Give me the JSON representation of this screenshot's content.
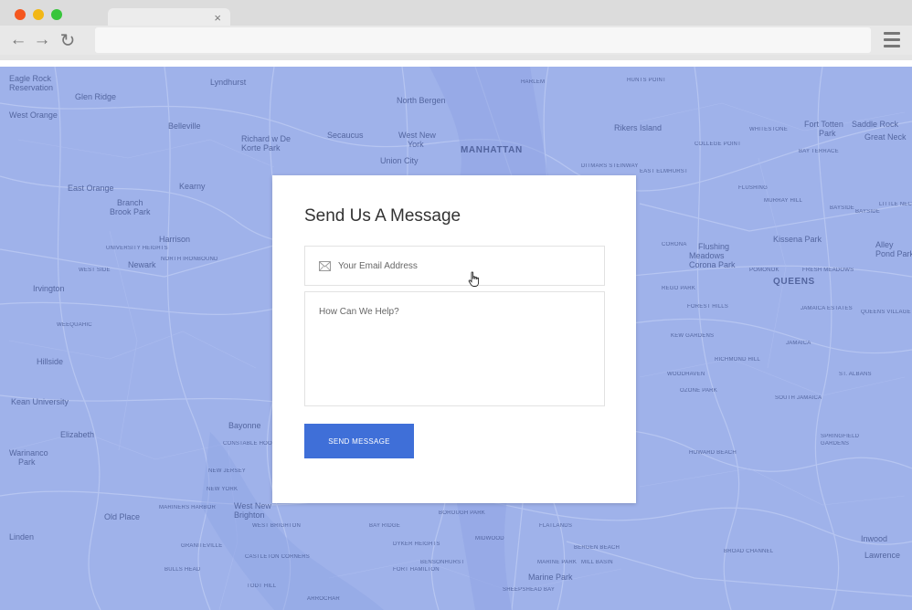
{
  "browser": {
    "dots": [
      {
        "name": "close-dot",
        "color": "#f5571f"
      },
      {
        "name": "minimize-dot",
        "color": "#f2b716"
      },
      {
        "name": "maximize-dot",
        "color": "#38c53c"
      }
    ],
    "tab_close_glyph": "×",
    "back_glyph": "←",
    "forward_glyph": "→",
    "reload_glyph": "↻",
    "address_value": ""
  },
  "map": {
    "labels": [
      {
        "text": "Eagle Rock",
        "cls": "ml-big"
      },
      {
        "text": "Reservation",
        "cls": "ml-big"
      },
      {
        "text": "Glen Ridge",
        "cls": "ml-big"
      },
      {
        "text": "Lyndhurst",
        "cls": "ml-big"
      },
      {
        "text": "North Bergen",
        "cls": "ml-big"
      },
      {
        "text": "HARLEM",
        "cls": "ml-small"
      },
      {
        "text": "HUNTS POINT",
        "cls": "ml-small"
      },
      {
        "text": "Fort Totten",
        "cls": "ml-big"
      },
      {
        "text": "Park",
        "cls": "ml-big"
      },
      {
        "text": "Saddle Rock",
        "cls": "ml-big"
      },
      {
        "text": "Great Neck",
        "cls": "ml-big"
      },
      {
        "text": "West Orange",
        "cls": "ml-big"
      },
      {
        "text": "Belleville",
        "cls": "ml-big"
      },
      {
        "text": "Richard w De",
        "cls": "ml-big"
      },
      {
        "text": "Korte Park",
        "cls": "ml-big"
      },
      {
        "text": "Secaucus",
        "cls": "ml-big"
      },
      {
        "text": "West New",
        "cls": "ml-big"
      },
      {
        "text": "York",
        "cls": "ml-big"
      },
      {
        "text": "MANHATTAN",
        "cls": "ml-bold"
      },
      {
        "text": "Rikers Island",
        "cls": "ml-big"
      },
      {
        "text": "WHITESTONE",
        "cls": "ml-small"
      },
      {
        "text": "COLLEGE POINT",
        "cls": "ml-small"
      },
      {
        "text": "BAY TERRACE",
        "cls": "ml-small"
      },
      {
        "text": "Union City",
        "cls": "ml-big"
      },
      {
        "text": "East Orange",
        "cls": "ml-big"
      },
      {
        "text": "Kearny",
        "cls": "ml-big"
      },
      {
        "text": "Branch",
        "cls": "ml-big"
      },
      {
        "text": "Brook Park",
        "cls": "ml-big"
      },
      {
        "text": "EAST ELMHURST",
        "cls": "ml-small"
      },
      {
        "text": "FLUSHING",
        "cls": "ml-small"
      },
      {
        "text": "MURRAY HILL",
        "cls": "ml-small"
      },
      {
        "text": "BAYSIDE",
        "cls": "ml-small"
      },
      {
        "text": "LITTLE NECK",
        "cls": "ml-small"
      },
      {
        "text": "Harrison",
        "cls": "ml-big"
      },
      {
        "text": "CORONA",
        "cls": "ml-small"
      },
      {
        "text": "Flushing",
        "cls": "ml-big"
      },
      {
        "text": "Meadows",
        "cls": "ml-big"
      },
      {
        "text": "Corona Park",
        "cls": "ml-big"
      },
      {
        "text": "Kissena Park",
        "cls": "ml-big"
      },
      {
        "text": "Alley",
        "cls": "ml-big"
      },
      {
        "text": "Pond Park",
        "cls": "ml-big"
      },
      {
        "text": "Newark",
        "cls": "ml-big"
      },
      {
        "text": "QUEENS",
        "cls": "ml-bold"
      },
      {
        "text": "Irvington",
        "cls": "ml-big"
      },
      {
        "text": "Hillside",
        "cls": "ml-big"
      },
      {
        "text": "Kean University",
        "cls": "ml-big"
      },
      {
        "text": "Elizabeth",
        "cls": "ml-big"
      },
      {
        "text": "Bayonne",
        "cls": "ml-big"
      },
      {
        "text": "Warinanco",
        "cls": "ml-big"
      },
      {
        "text": "Park",
        "cls": "ml-big"
      },
      {
        "text": "Old Place",
        "cls": "ml-big"
      },
      {
        "text": "West New",
        "cls": "ml-big"
      },
      {
        "text": "Brighton",
        "cls": "ml-big"
      },
      {
        "text": "Linden",
        "cls": "ml-big"
      },
      {
        "text": "REGO PARK",
        "cls": "ml-small"
      },
      {
        "text": "KEW GARDENS",
        "cls": "ml-small"
      },
      {
        "text": "JAMAICA ESTATES",
        "cls": "ml-small"
      },
      {
        "text": "QUEENS VILLAGE",
        "cls": "ml-small"
      },
      {
        "text": "RICHMOND HILL",
        "cls": "ml-small"
      },
      {
        "text": "JAMAICA",
        "cls": "ml-small"
      },
      {
        "text": "ST. ALBANS",
        "cls": "ml-small"
      },
      {
        "text": "WOODHAVEN",
        "cls": "ml-small"
      },
      {
        "text": "OZONE PARK",
        "cls": "ml-small"
      },
      {
        "text": "SOUTH JAMAICA",
        "cls": "ml-small"
      },
      {
        "text": "HOWARD BEACH",
        "cls": "ml-small"
      },
      {
        "text": "SPRINGFIELD",
        "cls": "ml-small"
      },
      {
        "text": "GARDENS",
        "cls": "ml-small"
      },
      {
        "text": "BOROUGH PARK",
        "cls": "ml-small"
      },
      {
        "text": "FLATLANDS",
        "cls": "ml-small"
      },
      {
        "text": "BAY RIDGE",
        "cls": "ml-small"
      },
      {
        "text": "MIDWOOD",
        "cls": "ml-small"
      },
      {
        "text": "BERGEN BEACH",
        "cls": "ml-small"
      },
      {
        "text": "MARINE PARK",
        "cls": "ml-small"
      },
      {
        "text": "MILL BASIN",
        "cls": "ml-small"
      },
      {
        "text": "Marine Park",
        "cls": "ml-big"
      },
      {
        "text": "BROAD CHANNEL",
        "cls": "ml-small"
      },
      {
        "text": "Inwood",
        "cls": "ml-big"
      },
      {
        "text": "Lawrence",
        "cls": "ml-big"
      },
      {
        "text": "SHEEPSHEAD BAY",
        "cls": "ml-small"
      },
      {
        "text": "ARROCHAR",
        "cls": "ml-small"
      },
      {
        "text": "TODT HILL",
        "cls": "ml-small"
      },
      {
        "text": "CASTLETON CORNERS",
        "cls": "ml-small"
      },
      {
        "text": "BULLS HEAD",
        "cls": "ml-small"
      },
      {
        "text": "GRANITEVILLE",
        "cls": "ml-small"
      },
      {
        "text": "MARINERS HARBOR",
        "cls": "ml-small"
      },
      {
        "text": "WEST BRIGHTON",
        "cls": "ml-small"
      },
      {
        "text": "NEW JERSEY",
        "cls": "ml-small"
      },
      {
        "text": "NEW YORK",
        "cls": "ml-small"
      },
      {
        "text": "CONSTABLE HOOK",
        "cls": "ml-small"
      },
      {
        "text": "DYKER HEIGHTS",
        "cls": "ml-small"
      },
      {
        "text": "BENSONHURST",
        "cls": "ml-small"
      },
      {
        "text": "FORT HAMILTON",
        "cls": "ml-small"
      },
      {
        "text": "UNIVERSITY HEIGHTS",
        "cls": "ml-small"
      },
      {
        "text": "WEST SIDE",
        "cls": "ml-small"
      },
      {
        "text": "NORTH IRONBOUND",
        "cls": "ml-small"
      },
      {
        "text": "WEEQUAHIC",
        "cls": "ml-small"
      },
      {
        "text": "DITMARS STEINWAY",
        "cls": "ml-small"
      },
      {
        "text": "FOREST HILLS",
        "cls": "ml-small"
      },
      {
        "text": "FRESH MEADOWS",
        "cls": "ml-small"
      },
      {
        "text": "POMONOK",
        "cls": "ml-small"
      },
      {
        "text": "BAYSIDE",
        "cls": "ml-small"
      }
    ]
  },
  "form": {
    "title": "Send Us A Message",
    "email_placeholder": "Your Email Address",
    "message_placeholder": "How Can We Help?",
    "send_label": "SEND MESSAGE"
  }
}
